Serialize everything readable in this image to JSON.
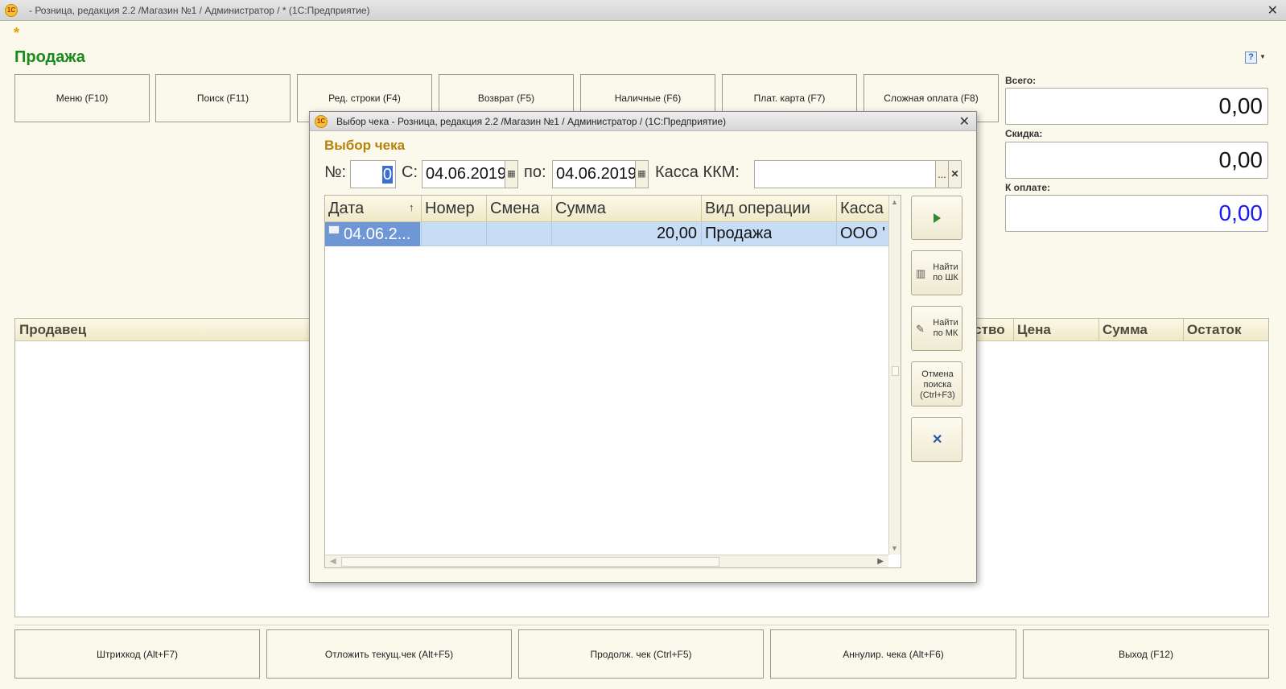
{
  "app": {
    "title": "- Розница, редакция 2.2 /Магазин №1 / Администратор / * (1С:Предприятие)",
    "logo_text": "1C",
    "close_glyph": "✕",
    "modified_marker": "*"
  },
  "page": {
    "title": "Продажа",
    "help_glyph": "?"
  },
  "function_buttons": [
    "Меню (F10)",
    "Поиск (F11)",
    "Ред. строки (F4)",
    "Возврат (F5)",
    "Наличные (F6)",
    "Плат. карта (F7)",
    "Сложная оплата (F8)"
  ],
  "totals": {
    "total_label": "Всего:",
    "total_value": "0,00",
    "discount_label": "Скидка:",
    "discount_value": "0,00",
    "to_pay_label": "К оплате:",
    "to_pay_value": "0,00",
    "to_pay_color": "#1a1aee"
  },
  "main_table": {
    "columns": [
      "Продавец",
      "ество",
      "Цена",
      "Сумма",
      "Остаток"
    ]
  },
  "bottom_buttons": [
    "Штрихкод (Alt+F7)",
    "Отложить текущ.чек (Alt+F5)",
    "Продолж. чек (Ctrl+F5)",
    "Аннулир. чека (Alt+F6)",
    "Выход (F12)"
  ],
  "dialog": {
    "title": "Выбор чека - Розница, редакция 2.2 /Магазин №1 / Администратор /  (1С:Предприятие)",
    "heading": "Выбор чека",
    "close_glyph": "✕",
    "filters": {
      "number_label": "№:",
      "number_value": "0",
      "from_label": "С:",
      "from_value": "04.06.2019",
      "to_label": "по:",
      "to_value": "04.06.2019",
      "register_label": "Касса ККМ:",
      "register_value": "",
      "ellipsis": "...",
      "clear_glyph": "✕",
      "calendar_glyph": "▦"
    },
    "grid": {
      "columns": [
        "Дата",
        "Номер",
        "Смена",
        "Сумма",
        "Вид операции",
        "Касса"
      ],
      "sort_indicator": "↑",
      "rows": [
        {
          "date": "04.06.2...",
          "number": "",
          "shift": "",
          "amount": "20,00",
          "operation": "Продажа",
          "register": "ООО '"
        }
      ]
    },
    "side_buttons": {
      "find_barcode": "Найти по ШК",
      "find_mk": "Найти по МК",
      "cancel_search": "Отмена поиска (Ctrl+F3)",
      "close_glyph": "✕"
    }
  }
}
